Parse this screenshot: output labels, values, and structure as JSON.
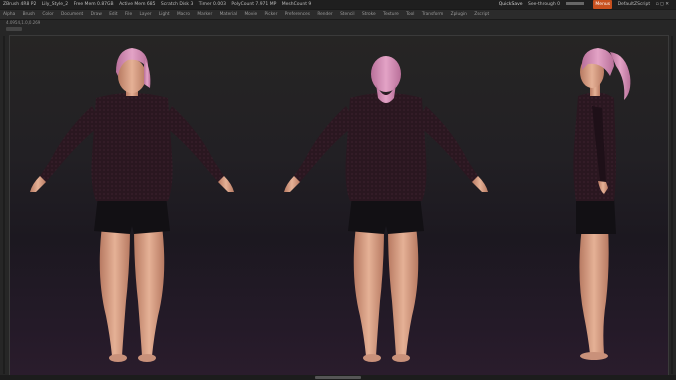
{
  "titlebar": {
    "app": "ZBrush 4R8 P2",
    "doc": "Lily_Style_2",
    "free_mem": "Free Mem 0.87GB",
    "active_mem": "Active Mem 685",
    "scratch": "Scratch Disk 3",
    "timer": "Timer 0.003",
    "poly_count": "PolyCount 7.971 MP",
    "mesh_count": "MeshCount 9",
    "quicksave": "QuickSave",
    "see_through": "See-through 0",
    "menus": "Menus",
    "script": "DefaultZScript"
  },
  "menubar": {
    "items": [
      "Alpha",
      "Brush",
      "Color",
      "Document",
      "Draw",
      "Edit",
      "File",
      "Layer",
      "Light",
      "Macro",
      "Marker",
      "Material",
      "Movie",
      "Picker",
      "Preferences",
      "Render",
      "Stencil",
      "Stroke",
      "Texture",
      "Tool",
      "Transform",
      "Zplugin",
      "Zscript"
    ]
  },
  "info": {
    "text": "4.0954,1.0,0.269"
  },
  "scene": {
    "skin_color": "#e0a98a",
    "hair_color": "#d48fb3",
    "shirt_color": "#2a1720",
    "shorts_color": "#121014"
  }
}
